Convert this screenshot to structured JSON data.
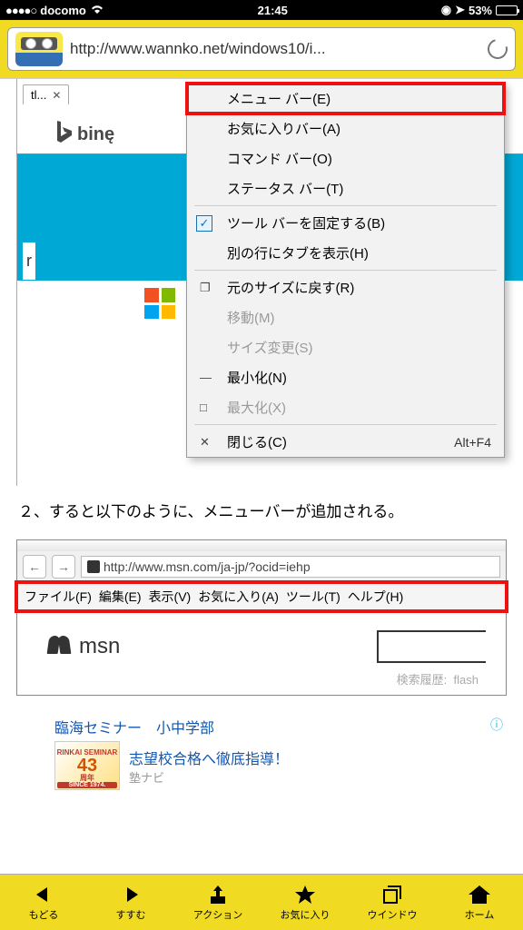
{
  "status": {
    "dots": "●●●●○",
    "carrier": "docomo",
    "time": "21:45",
    "battery_pct": "53%"
  },
  "browser": {
    "url": "http://www.wannko.net/windows10/i..."
  },
  "shot1": {
    "tab_label": "tl...",
    "bing_label": "binę",
    "r_label": "r",
    "menu": {
      "menubar": "メニュー バー(E)",
      "favbar": "お気に入りバー(A)",
      "cmdbar": "コマンド バー(O)",
      "statusbar": "ステータス バー(T)",
      "locktoolbar": "ツール バーを固定する(B)",
      "tabsrow": "別の行にタブを表示(H)",
      "restore": "元のサイズに戻す(R)",
      "move": "移動(M)",
      "resize": "サイズ変更(S)",
      "minimize": "最小化(N)",
      "maximize": "最大化(X)",
      "close": "閉じる(C)",
      "close_shortcut": "Alt+F4"
    },
    "ms_label": "Microsoft"
  },
  "caption": "２、すると以下のように、メニューバーが追加される。",
  "shot2": {
    "url": "http://www.msn.com/ja-jp/?ocid=iehp",
    "menubar": {
      "file": "ファイル(F)",
      "edit": "編集(E)",
      "view": "表示(V)",
      "fav": "お気に入り(A)",
      "tools": "ツール(T)",
      "help": "ヘルプ(H)"
    },
    "msn_label": "msn",
    "hint_label": "検索履歴:",
    "hint_item": "flash"
  },
  "ad": {
    "title": "臨海セミナー　小中学部",
    "subtitle": "志望校合格へ徹底指導！",
    "source": "塾ナビ",
    "badge_text": "RINKAI SEMINAR",
    "badge_num": "43",
    "badge_suffix": "周年",
    "badge_since": "SINCE 1974."
  },
  "bottombar": {
    "back": "もどる",
    "forward": "すすむ",
    "action": "アクション",
    "favorites": "お気に入り",
    "window": "ウインドウ",
    "home": "ホーム"
  }
}
